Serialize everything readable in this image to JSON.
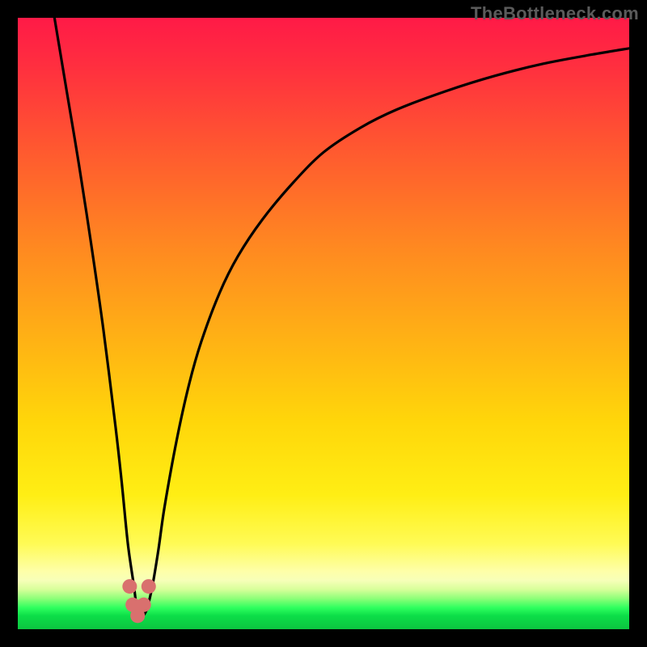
{
  "watermark": "TheBottleneck.com",
  "chart_data": {
    "type": "line",
    "title": "",
    "xlabel": "",
    "ylabel": "",
    "xlim": [
      0,
      100
    ],
    "ylim": [
      0,
      100
    ],
    "grid": false,
    "legend": false,
    "background_gradient": {
      "direction": "vertical",
      "stops": [
        {
          "pos": 0.0,
          "color": "#ff1a47"
        },
        {
          "pos": 0.38,
          "color": "#ff8a20"
        },
        {
          "pos": 0.66,
          "color": "#ffd60a"
        },
        {
          "pos": 0.9,
          "color": "#feffa8"
        },
        {
          "pos": 0.97,
          "color": "#2eff5e"
        },
        {
          "pos": 1.0,
          "color": "#0cc540"
        }
      ]
    },
    "series": [
      {
        "name": "bottleneck-curve",
        "color": "#000000",
        "x": [
          6,
          8,
          10,
          12,
          14,
          16,
          17,
          18,
          19,
          19.5,
          20,
          21,
          22,
          23,
          24,
          26,
          28,
          30,
          33,
          36,
          40,
          45,
          50,
          56,
          62,
          70,
          78,
          86,
          94,
          100
        ],
        "y": [
          100,
          88,
          76,
          63,
          49,
          33,
          24,
          14,
          7,
          3,
          2,
          3,
          7,
          13,
          20,
          31,
          40,
          47,
          55,
          61,
          67,
          73,
          78,
          82,
          85,
          88,
          90.5,
          92.5,
          94,
          95
        ]
      }
    ],
    "markers": [
      {
        "name": "min-marker-left",
        "x": 18.3,
        "y": 7.0,
        "color": "#d9706e",
        "size": 9
      },
      {
        "name": "min-marker-left2",
        "x": 18.8,
        "y": 4.0,
        "color": "#d9706e",
        "size": 9
      },
      {
        "name": "min-marker-bottom",
        "x": 19.6,
        "y": 2.2,
        "color": "#d9706e",
        "size": 9
      },
      {
        "name": "min-marker-right2",
        "x": 20.6,
        "y": 4.0,
        "color": "#d9706e",
        "size": 9
      },
      {
        "name": "min-marker-right",
        "x": 21.4,
        "y": 7.0,
        "color": "#d9706e",
        "size": 9
      }
    ]
  }
}
